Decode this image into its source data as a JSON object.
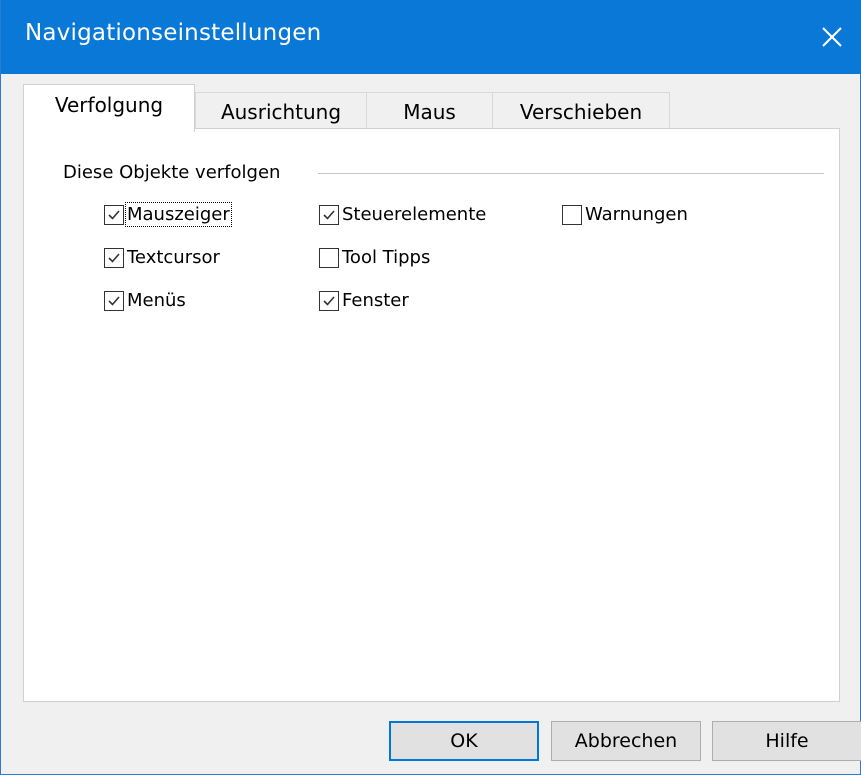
{
  "window": {
    "title": "Navigationseinstellungen"
  },
  "tabs": [
    {
      "label": "Verfolgung",
      "active": true
    },
    {
      "label": "Ausrichtung",
      "active": false
    },
    {
      "label": "Maus",
      "active": false
    },
    {
      "label": "Verschieben",
      "active": false
    }
  ],
  "group": {
    "label": "Diese Objekte verfolgen",
    "checkboxes": [
      {
        "label": "Mauszeiger",
        "checked": true
      },
      {
        "label": "Textcursor",
        "checked": true
      },
      {
        "label": "Menüs",
        "checked": true
      },
      {
        "label": "Steuerelemente",
        "checked": true
      },
      {
        "label": "Tool Tipps",
        "checked": false
      },
      {
        "label": "Fenster",
        "checked": true
      },
      {
        "label": "Warnungen",
        "checked": false
      }
    ]
  },
  "buttons": {
    "ok": "OK",
    "cancel": "Abbrechen",
    "help": "Hilfe"
  },
  "colors": {
    "titlebar": "#0a78d7",
    "accent": "#0078d7"
  }
}
